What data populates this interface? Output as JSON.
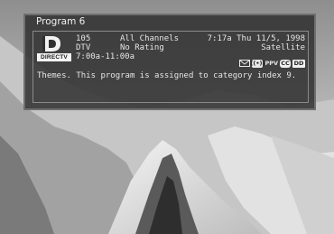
{
  "panel": {
    "title": "Program 6",
    "logo": {
      "name": "directv-logo",
      "text": "DIRECTV"
    },
    "channel": "105",
    "network": "DTV",
    "time_range": "7:00a-11:00a",
    "channel_list": "All Channels",
    "rating": "No Rating",
    "datetime": "7:17a Thu 11/5, 1998",
    "source": "Satellite",
    "description": "Themes. This program is assigned to category index 9.",
    "icons": {
      "mail": "mail-icon",
      "signal": "signal-icon",
      "ppv_label": "PPV",
      "cc_label": "CC",
      "dolby_label": "DD"
    }
  },
  "colors": {
    "panel_bg": "#303030",
    "text": "#e6e6e6",
    "border": "#8a8a8a"
  }
}
